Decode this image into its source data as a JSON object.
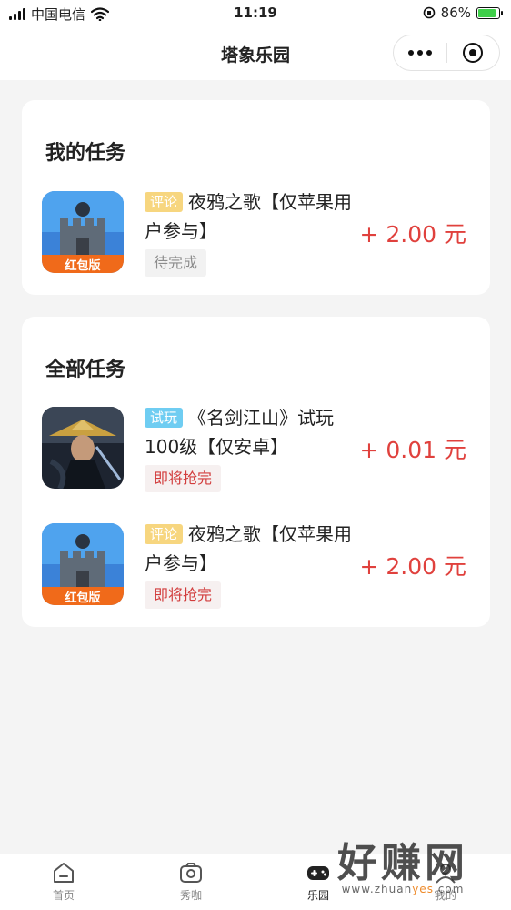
{
  "status_bar": {
    "carrier": "中国电信",
    "time": "11:19",
    "battery": "86%"
  },
  "nav": {
    "title": "塔象乐园"
  },
  "my_tasks": {
    "title": "我的任务",
    "items": [
      {
        "tag": "评论",
        "tag_color": "#f7d67f",
        "title": "夜鸦之歌【仅苹果用户参与】",
        "status": "待完成",
        "reward": "+ 2.00 元",
        "icon": "tower-game-icon",
        "icon_badge": "红包版"
      }
    ]
  },
  "all_tasks": {
    "title": "全部任务",
    "items": [
      {
        "tag": "试玩",
        "tag_color": "#6fcdf2",
        "title": "《名剑江山》试玩100级【仅安卓】",
        "status": "即将抢完",
        "reward": "+ 0.01 元",
        "icon": "swordsman-game-icon"
      },
      {
        "tag": "评论",
        "tag_color": "#f7d67f",
        "title": "夜鸦之歌【仅苹果用户参与】",
        "status": "即将抢完",
        "reward": "+ 2.00 元",
        "icon": "tower-game-icon",
        "icon_badge": "红包版"
      }
    ]
  },
  "tabbar": {
    "items": [
      {
        "label": "首页",
        "icon": "home-icon"
      },
      {
        "label": "秀咖",
        "icon": "camera-icon"
      },
      {
        "label": "乐园",
        "icon": "gamepad-icon",
        "active": true
      },
      {
        "label": "我的",
        "icon": "user-icon"
      }
    ]
  },
  "watermark": {
    "big": "好赚网",
    "small_pre": "www.zhuan",
    "small_hl": "yes",
    "small_post": ".com"
  },
  "colors": {
    "reward": "#e0413d",
    "urgent": "#d23c3c",
    "background": "#f4f4f4"
  }
}
